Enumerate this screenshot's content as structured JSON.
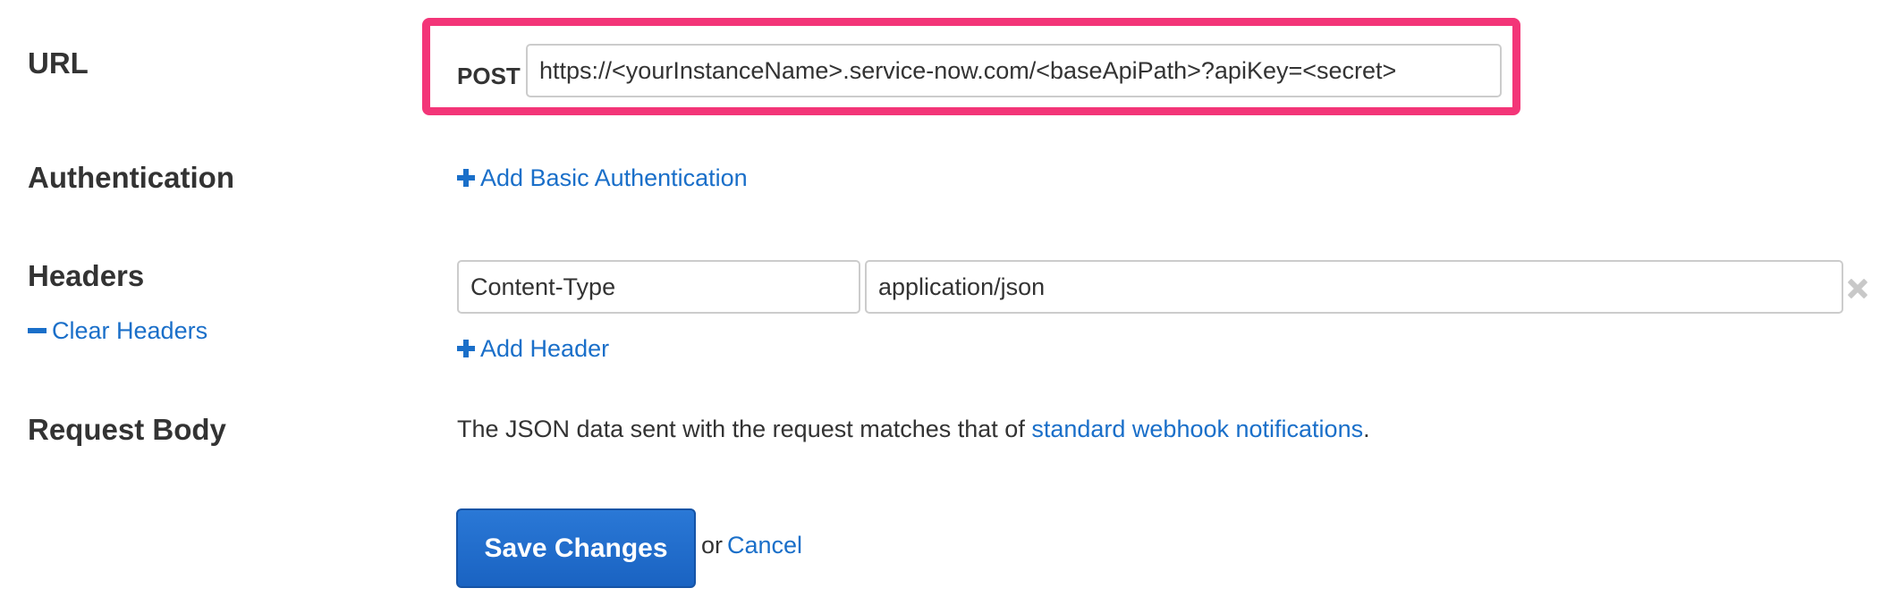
{
  "colors": {
    "highlight_border": "#f33578",
    "link": "#1a6fc9",
    "primary_button": "#1a63c2",
    "text": "#333333"
  },
  "url_section": {
    "label": "URL",
    "method": "POST",
    "url_value": "https://<yourInstanceName>.service-now.com/<baseApiPath>?apiKey=<secret>"
  },
  "auth_section": {
    "label": "Authentication",
    "add_basic_auth": "Add Basic Authentication"
  },
  "headers_section": {
    "label": "Headers",
    "clear_headers": "Clear Headers",
    "headers": [
      {
        "name": "Content-Type",
        "value": "application/json"
      }
    ],
    "add_header": "Add Header"
  },
  "body_section": {
    "label": "Request Body",
    "description_prefix": "The JSON data sent with the request matches that of ",
    "description_link": "standard webhook notifications",
    "description_suffix": "."
  },
  "actions": {
    "save": "Save Changes",
    "or": "or",
    "cancel": "Cancel"
  },
  "icons": {
    "add": "plus-icon",
    "clear": "minus-icon",
    "remove": "close-icon"
  }
}
